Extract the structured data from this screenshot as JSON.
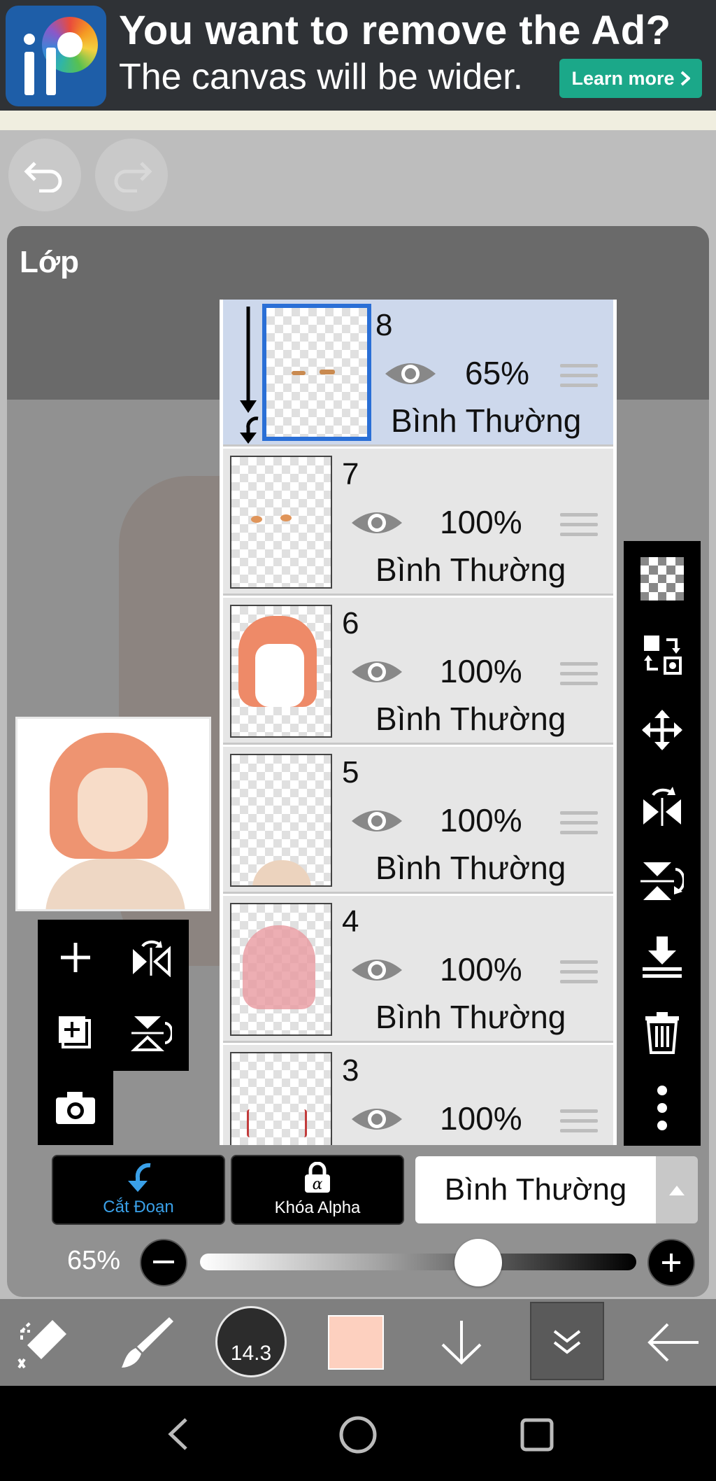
{
  "ad": {
    "title": "You want to remove the Ad?",
    "subtitle": "The canvas will be wider.",
    "button": "Learn more"
  },
  "panel": {
    "title": "Lớp"
  },
  "layers": [
    {
      "number": "8",
      "opacity": "65%",
      "blend": "Bình Thường",
      "selected": true
    },
    {
      "number": "7",
      "opacity": "100%",
      "blend": "Bình Thường",
      "selected": false
    },
    {
      "number": "6",
      "opacity": "100%",
      "blend": "Bình Thường",
      "selected": false
    },
    {
      "number": "5",
      "opacity": "100%",
      "blend": "Bình Thường",
      "selected": false
    },
    {
      "number": "4",
      "opacity": "100%",
      "blend": "Bình Thường",
      "selected": false
    },
    {
      "number": "3",
      "opacity": "100%",
      "blend": "Bình Thường",
      "selected": false
    }
  ],
  "controls": {
    "clip_label": "Cắt Đoạn",
    "alpha_lock_label": "Khóa Alpha",
    "blend_mode": "Bình Thường",
    "opacity_label": "65%",
    "opacity_value": 0.65
  },
  "toolbar": {
    "brush_size": "14.3",
    "color": "#fdd0bf"
  },
  "colors": {
    "selected_row": "#cdd8ec",
    "selection_border": "#2a6fd6",
    "clip_accent": "#3aa0e8",
    "ad_button": "#1ba889"
  },
  "icons": {
    "right_toolbar": [
      "transparency-icon",
      "transfer-icon",
      "move-icon",
      "flip-horizontal-icon",
      "flip-vertical-icon",
      "merge-down-icon",
      "trash-icon",
      "more-icon"
    ],
    "mini_toolbar": [
      "add-layer-icon",
      "flip-layer-icon",
      "duplicate-layer-icon",
      "flip-vertical-layer-icon",
      "camera-icon"
    ]
  }
}
